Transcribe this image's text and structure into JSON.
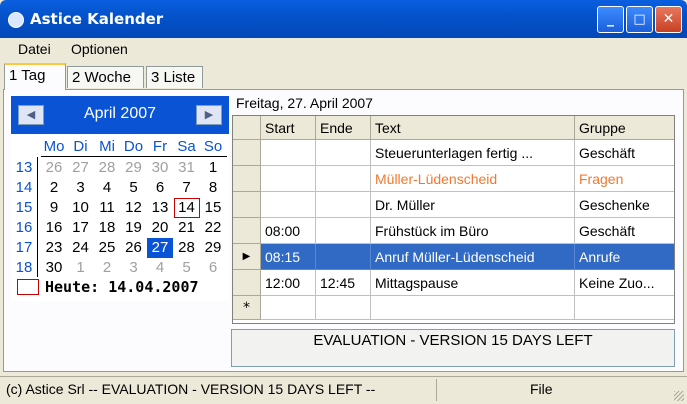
{
  "window": {
    "title": "Astice Kalender",
    "minimize_glyph": "_",
    "maximize_glyph": "□",
    "close_glyph": "✕"
  },
  "menu": [
    {
      "label": "Datei"
    },
    {
      "label": "Optionen"
    }
  ],
  "tabs": [
    {
      "label": "1 Tag"
    },
    {
      "label": "2 Woche"
    },
    {
      "label": "3 Liste"
    }
  ],
  "calendar": {
    "month_label": "April 2007",
    "prev_glyph": "◀",
    "next_glyph": "▶",
    "days_of_week": [
      "Mo",
      "Di",
      "Mi",
      "Do",
      "Fr",
      "Sa",
      "So"
    ],
    "weeks": [
      {
        "week": "13",
        "days": [
          "26",
          "27",
          "28",
          "29",
          "30",
          "31",
          "1"
        ]
      },
      {
        "week": "14",
        "days": [
          "2",
          "3",
          "4",
          "5",
          "6",
          "7",
          "8"
        ]
      },
      {
        "week": "15",
        "days": [
          "9",
          "10",
          "11",
          "12",
          "13",
          "14",
          "15"
        ]
      },
      {
        "week": "16",
        "days": [
          "16",
          "17",
          "18",
          "19",
          "20",
          "21",
          "22"
        ]
      },
      {
        "week": "17",
        "days": [
          "23",
          "24",
          "25",
          "26",
          "27",
          "28",
          "29"
        ]
      },
      {
        "week": "18",
        "days": [
          "30",
          "1",
          "2",
          "3",
          "4",
          "5",
          "6"
        ]
      }
    ],
    "today_label": "Heute: 14.04.2007",
    "accent_color": "#0a53d4",
    "today_color": "#c80000"
  },
  "day_view": {
    "date_label": "Freitag, 27. April 2007",
    "columns": [
      "Start",
      "Ende",
      "Text",
      "Gruppe"
    ],
    "rows": [
      {
        "start": "",
        "end": "",
        "text": "Steuerunterlagen fertig ...",
        "group": "Geschäft"
      },
      {
        "start": "",
        "end": "",
        "text": "Müller-Lüdenscheid",
        "group": "Fragen"
      },
      {
        "start": "",
        "end": "",
        "text": "Dr. Müller",
        "group": "Geschenke"
      },
      {
        "start": "08:00",
        "end": "",
        "text": "Frühstück im Büro",
        "group": "Geschäft"
      },
      {
        "start": "08:15",
        "end": "",
        "text": "Anruf  Müller-Lüdenscheid",
        "group": "Anrufe"
      },
      {
        "start": "12:00",
        "end": "12:45",
        "text": "Mittagspause",
        "group": "Keine Zuo..."
      }
    ],
    "current_row_marker": "▶",
    "new_row_marker": "*",
    "highlight_color": "#f07830",
    "selection_color": "#316ac5"
  },
  "evaluation_banner": "EVALUATION - VERSION    15 DAYS LEFT",
  "statusbar": {
    "left": "(c) Astice Srl  --  EVALUATION - VERSION    15 DAYS LEFT  --",
    "right": "File"
  }
}
